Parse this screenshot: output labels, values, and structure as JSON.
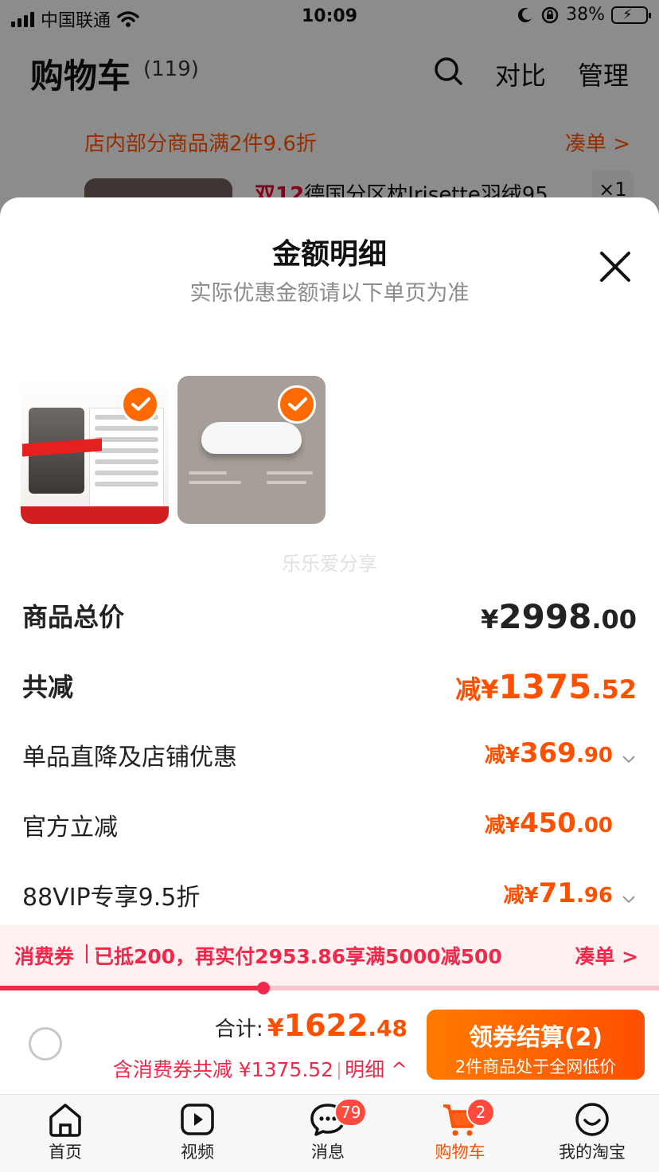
{
  "status_bar": {
    "carrier": "中国联通",
    "time": "10:09",
    "battery": "38%"
  },
  "cart_header": {
    "title": "购物车",
    "count": "(119)",
    "compare": "对比",
    "manage": "管理"
  },
  "promo": {
    "text": "店内部分商品满2件9.6折",
    "link": "凑单 >"
  },
  "background_item": {
    "tag": "双12",
    "title": "德国分区枕Irisette羽绒95",
    "qty": "×1"
  },
  "sheet": {
    "title": "金额明细",
    "subtitle": "实际优惠金额请以下单页为准",
    "watermark": "乐乐爱分享",
    "products": [
      {
        "name": "coffee-machine",
        "checked": true
      },
      {
        "name": "pillow",
        "checked": true
      }
    ]
  },
  "breakdown": {
    "total": {
      "label": "商品总价",
      "currency": "¥",
      "integer": "2998",
      "decimal": ".00"
    },
    "reduced": {
      "label": "共减",
      "prefix": "减¥",
      "integer": "1375",
      "decimal": ".52"
    },
    "store": {
      "label": "单品直降及店铺优惠",
      "prefix": "减¥",
      "integer": "369",
      "decimal": ".90"
    },
    "official": {
      "label": "官方立减",
      "prefix": "减¥",
      "integer": "450",
      "decimal": ".00"
    },
    "vip": {
      "label": "88VIP专享9.5折",
      "prefix": "减¥",
      "integer": "71",
      "decimal": ".96"
    }
  },
  "coupon": {
    "label": "消费券",
    "text": "已抵200，再实付2953.86享满5000减500",
    "link": "凑单 >",
    "progress": 0.4
  },
  "checkout": {
    "total_label": "合计:",
    "currency": "¥",
    "integer": "1622",
    "decimal": ".48",
    "saving_text": "含消费券共减 ¥1375.52",
    "detail_link": "明细 ^",
    "button_main": "领券结算(2)",
    "button_sub": "2件商品处于全网低价"
  },
  "tabbar": [
    {
      "label": "首页",
      "icon": "home-icon"
    },
    {
      "label": "视频",
      "icon": "video-icon"
    },
    {
      "label": "消息",
      "icon": "message-icon",
      "badge": "79"
    },
    {
      "label": "购物车",
      "icon": "cart-icon",
      "badge": "2",
      "active": true
    },
    {
      "label": "我的淘宝",
      "icon": "profile-icon"
    }
  ],
  "colors": {
    "accent": "#ff5000",
    "coupon": "#f0284a",
    "checkbox": "#ff6a00"
  }
}
